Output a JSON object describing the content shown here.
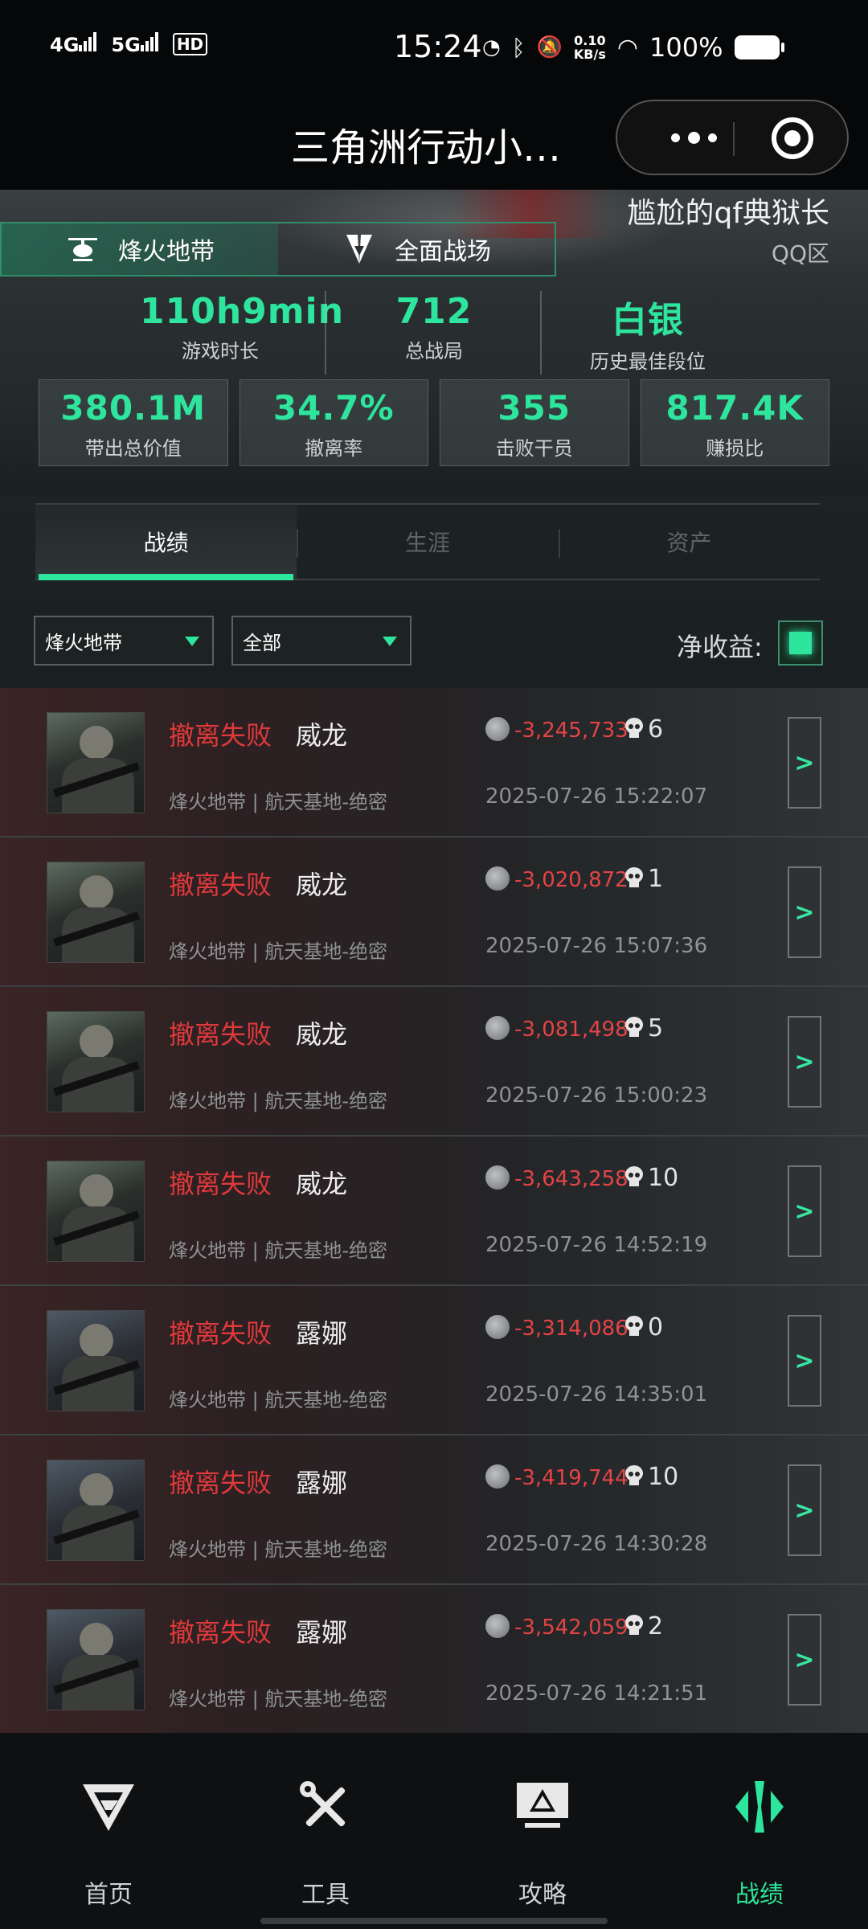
{
  "status_bar": {
    "network1": "4G",
    "network2": "5G",
    "hd": "HD",
    "time": "15:24",
    "speed_value": "0.10",
    "speed_unit": "KB/s",
    "battery": "100%"
  },
  "title_bar": {
    "title": "三角洲行动小…"
  },
  "hero": {
    "mode_tabs": [
      "烽火地带",
      "全面战场"
    ],
    "player_name": "尴尬的qf典狱长",
    "region": "QQ区",
    "top_stats": [
      {
        "value": "110h9min",
        "label": "游戏时长"
      },
      {
        "value": "712",
        "label": "总战局"
      },
      {
        "value": "白银",
        "label": "历史最佳段位"
      }
    ],
    "box_stats": [
      {
        "value": "380.1M",
        "label": "带出总价值"
      },
      {
        "value": "34.7%",
        "label": "撤离率"
      },
      {
        "value": "355",
        "label": "击败干员"
      },
      {
        "value": "817.4K",
        "label": "赚损比"
      }
    ]
  },
  "section_tabs": [
    "战绩",
    "生涯",
    "资产"
  ],
  "filters": {
    "map_mode": "烽火地带",
    "scope": "全部",
    "net_label": "净收益:"
  },
  "records": [
    {
      "status": "撤离失败",
      "operator": "威龙",
      "detail": "烽火地带 | 航天基地-绝密",
      "value": "-3,245,733",
      "kills": "6",
      "time": "2025-07-26 15:22:07"
    },
    {
      "status": "撤离失败",
      "operator": "威龙",
      "detail": "烽火地带 | 航天基地-绝密",
      "value": "-3,020,872",
      "kills": "1",
      "time": "2025-07-26 15:07:36"
    },
    {
      "status": "撤离失败",
      "operator": "威龙",
      "detail": "烽火地带 | 航天基地-绝密",
      "value": "-3,081,498",
      "kills": "5",
      "time": "2025-07-26 15:00:23"
    },
    {
      "status": "撤离失败",
      "operator": "威龙",
      "detail": "烽火地带 | 航天基地-绝密",
      "value": "-3,643,258",
      "kills": "10",
      "time": "2025-07-26 14:52:19"
    },
    {
      "status": "撤离失败",
      "operator": "露娜",
      "detail": "烽火地带 | 航天基地-绝密",
      "value": "-3,314,086",
      "kills": "0",
      "time": "2025-07-26 14:35:01"
    },
    {
      "status": "撤离失败",
      "operator": "露娜",
      "detail": "烽火地带 | 航天基地-绝密",
      "value": "-3,419,744",
      "kills": "10",
      "time": "2025-07-26 14:30:28"
    },
    {
      "status": "撤离失败",
      "operator": "露娜",
      "detail": "烽火地带 | 航天基地-绝密",
      "value": "-3,542,059",
      "kills": "2",
      "time": "2025-07-26 14:21:51"
    }
  ],
  "go_label": ">",
  "bottom_nav": [
    {
      "label": "首页",
      "icon": "home-logo-icon"
    },
    {
      "label": "工具",
      "icon": "tools-icon"
    },
    {
      "label": "攻略",
      "icon": "guide-monitor-icon"
    },
    {
      "label": "战绩",
      "icon": "record-icon"
    }
  ],
  "colors": {
    "accent": "#2ee59d",
    "fail": "#e0393b"
  }
}
